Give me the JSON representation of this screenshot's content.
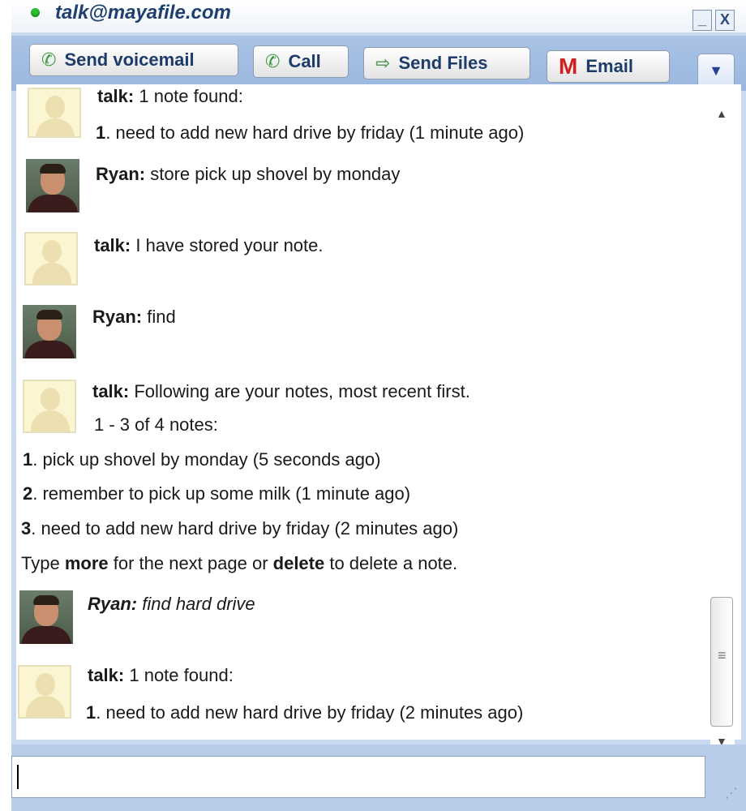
{
  "window": {
    "title": "talk@mayafile.com",
    "minimize": "_",
    "close": "X"
  },
  "toolbar": {
    "send_voicemail": "Send voicemail",
    "call": "Call",
    "send_files": "Send Files",
    "email": "Email",
    "more": "▼"
  },
  "messages": [
    {
      "sender": "talk:",
      "text": " 1 note found:"
    },
    {
      "num": "1",
      "text": ". need to add new hard drive by friday (1 minute ago)"
    },
    {
      "sender": "Ryan:",
      "text": " store pick up shovel by monday"
    },
    {
      "sender": "talk:",
      "text": " I have stored your note."
    },
    {
      "sender": "Ryan:",
      "text": " find"
    },
    {
      "sender": "talk:",
      "text": " Following are your notes, most recent first."
    },
    {
      "text": "1 - 3 of 4 notes:"
    },
    {
      "num": "1",
      "text": ". pick up shovel by monday (5 seconds ago)"
    },
    {
      "num": "2",
      "text": ". remember to pick up some milk (1 minute ago)"
    },
    {
      "num": "3",
      "text": ". need to add new hard drive by friday (2 minutes ago)"
    },
    {
      "pre": "Type ",
      "kw1": "more",
      "mid": " for the next page or ",
      "kw2": "delete",
      "post": " to delete a note."
    },
    {
      "sender": "Ryan:",
      "text": " find hard drive"
    },
    {
      "sender": "talk:",
      "text": " 1 note found:"
    },
    {
      "num": "1",
      "text": ". need to add new hard drive by friday (2 minutes ago)"
    }
  ],
  "input": {
    "value": ""
  }
}
